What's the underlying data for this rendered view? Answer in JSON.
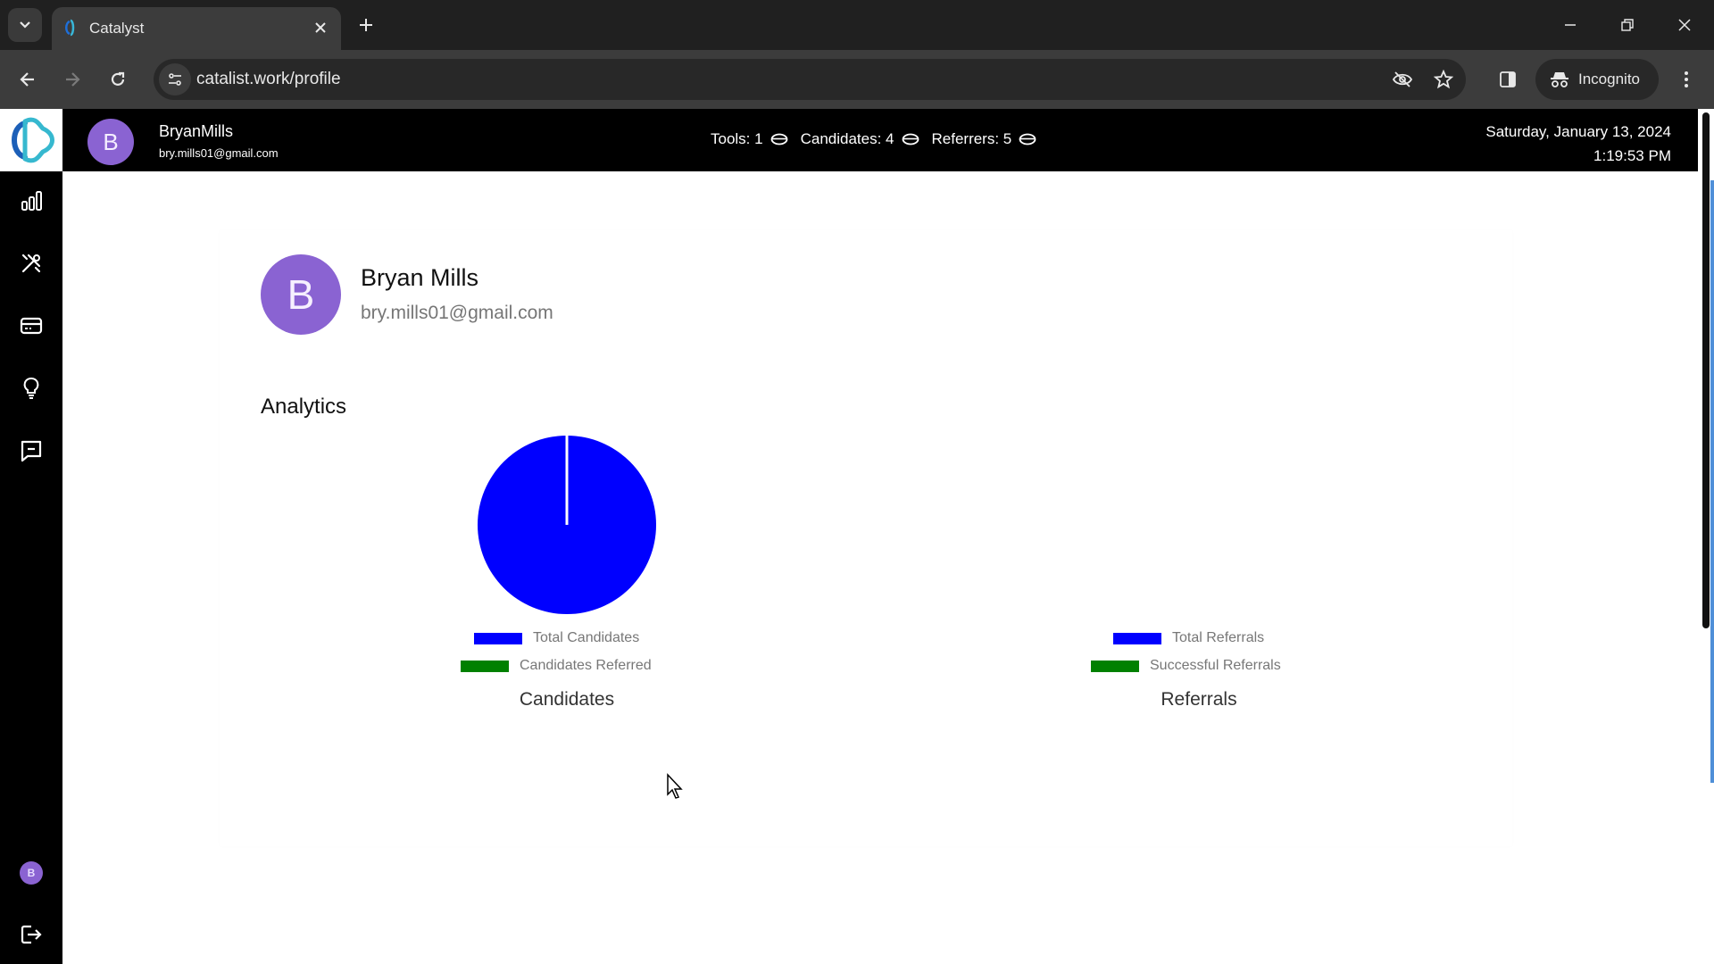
{
  "browser": {
    "tab": {
      "title": "Catalyst",
      "favicon": "catalyst-logo-icon"
    },
    "url": "catalist.work/profile",
    "incognito_label": "Incognito",
    "icons": {
      "tab_list": "chevron-down-icon",
      "close_tab": "close-icon",
      "new_tab": "plus-icon",
      "minimize": "minimize-icon",
      "restore": "restore-icon",
      "close_window": "close-icon",
      "back": "arrow-left-icon",
      "forward": "arrow-right-icon",
      "reload": "reload-icon",
      "site_info": "tune-icon",
      "tracking": "eye-off-icon",
      "bookmark": "star-icon",
      "side_panel": "side-panel-icon",
      "incognito": "incognito-icon",
      "menu": "kebab-menu-icon"
    }
  },
  "sidebar": {
    "logo": "catalyst-logo-icon",
    "items": [
      {
        "name": "analytics",
        "icon": "bar-chart-icon"
      },
      {
        "name": "tools",
        "icon": "tools-icon"
      },
      {
        "name": "billing",
        "icon": "credit-card-icon"
      },
      {
        "name": "ideas",
        "icon": "lightbulb-icon"
      },
      {
        "name": "messages",
        "icon": "chat-icon"
      }
    ],
    "user_avatar_initial": "B",
    "logout_icon": "logout-icon"
  },
  "header": {
    "avatar_initial": "B",
    "username": "BryanMills",
    "email": "bry.mills01@gmail.com",
    "stats": [
      {
        "label": "Tools: 1",
        "icon": "coin-icon"
      },
      {
        "label": "Candidates: 4",
        "icon": "coin-icon"
      },
      {
        "label": "Referrers: 5",
        "icon": "coin-icon"
      }
    ],
    "date": "Saturday, January 13, 2024",
    "time": "1:19:53 PM"
  },
  "profile": {
    "avatar_initial": "B",
    "name": "Bryan Mills",
    "email": "bry.mills01@gmail.com"
  },
  "analytics": {
    "title": "Analytics"
  },
  "colors": {
    "avatar": "#8a63d2",
    "series_primary": "#0000ff",
    "series_secondary": "#008000",
    "header_bg": "#000000"
  },
  "chart_data": [
    {
      "type": "pie",
      "title": "Candidates",
      "legend_position": "bottom",
      "labels": [
        "Total Candidates",
        "Candidates Referred"
      ],
      "values": [
        4,
        0
      ],
      "colors": [
        "#0000ff",
        "#008000"
      ]
    },
    {
      "type": "pie",
      "title": "Referrals",
      "legend_position": "bottom",
      "labels": [
        "Total Referrals",
        "Successful Referrals"
      ],
      "values": [
        0,
        0
      ],
      "colors": [
        "#0000ff",
        "#008000"
      ]
    }
  ]
}
